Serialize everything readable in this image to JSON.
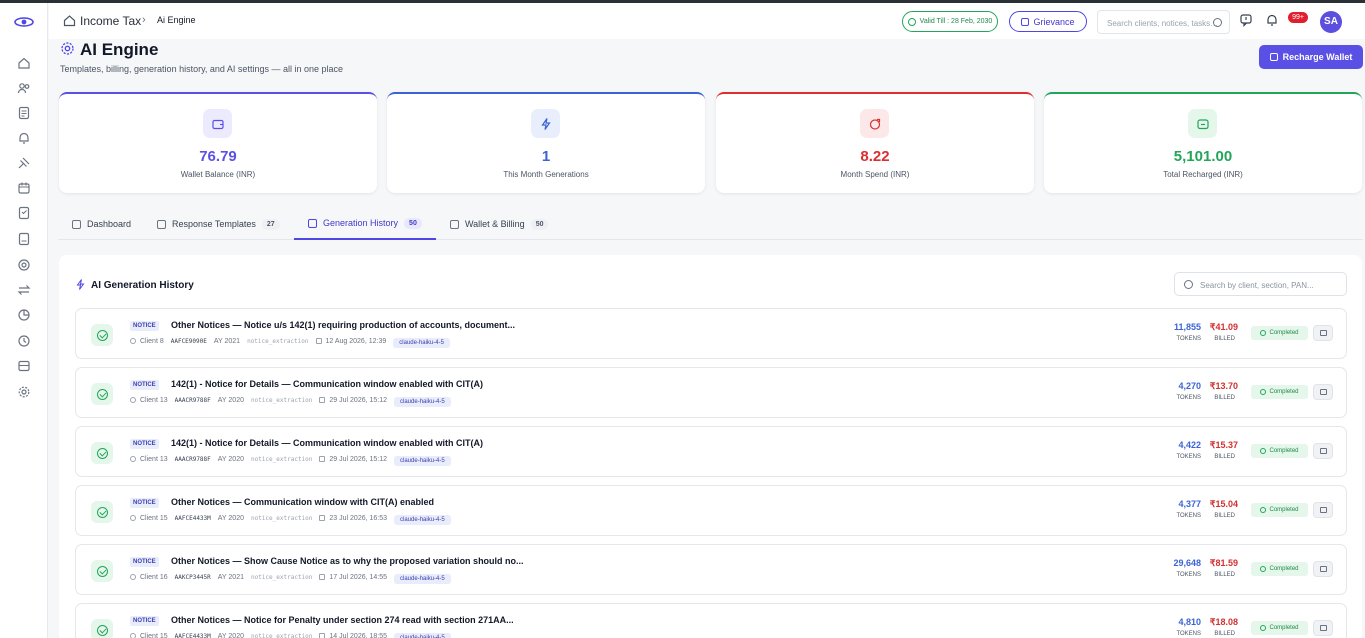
{
  "header": {
    "breadcrumb": [
      "Income Tax",
      "Ai Engine"
    ],
    "breadcrumb_sep": "›",
    "valid_till": "Valid Till : 28 Feb, 2030",
    "grievance_label": "Grievance",
    "search_placeholder": "Search clients, notices, tasks…",
    "notifications_badge": "99+",
    "avatar_initials": "SA"
  },
  "page": {
    "title": "AI Engine",
    "subtitle": "Templates, billing, generation history, and AI settings — all in one place",
    "recharge_label": "Recharge Wallet"
  },
  "stats": [
    {
      "value": "76.79",
      "label": "Wallet Balance (INR)",
      "color": "#5b50e6",
      "icon": "wallet-icon"
    },
    {
      "value": "1",
      "label": "This Month Generations",
      "color": "#3b63d6",
      "icon": "lightning-icon"
    },
    {
      "value": "8.22",
      "label": "Month Spend (INR)",
      "color": "#dc2f2f",
      "icon": "spend-icon"
    },
    {
      "value": "5,101.00",
      "label": "Total Recharged (INR)",
      "color": "#22a55a",
      "icon": "recharge-icon"
    }
  ],
  "tabs": [
    {
      "label": "Dashboard",
      "count": ""
    },
    {
      "label": "Response Templates",
      "count": "27"
    },
    {
      "label": "Generation History",
      "count": "50",
      "active": true
    },
    {
      "label": "Wallet & Billing",
      "count": "50"
    }
  ],
  "history": {
    "title": "AI Generation History",
    "search_placeholder": "Search by client, section, PAN...",
    "tokens_label": "TOKENS",
    "billed_label": "BILLED",
    "rows": [
      {
        "tag": "NOTICE",
        "title": "Other Notices — Notice u/s 142(1) requiring production of accounts, document...",
        "client": "Client 8",
        "pan": "AAFCE9090E",
        "ay": "AY 2021",
        "section": "notice_extraction",
        "date": "12 Aug 2026, 12:39",
        "model": "claude-haiku-4-5",
        "tokens": "11,855",
        "billed": "₹41.09",
        "status": "Completed"
      },
      {
        "tag": "NOTICE",
        "title": "142(1) - Notice for Details — Communication window enabled with CIT(A)",
        "client": "Client 13",
        "pan": "AAACR9788F",
        "ay": "AY 2020",
        "section": "notice_extraction",
        "date": "29 Jul 2026, 15:12",
        "model": "claude-haiku-4-5",
        "tokens": "4,270",
        "billed": "₹13.70",
        "status": "Completed"
      },
      {
        "tag": "NOTICE",
        "title": "142(1) - Notice for Details — Communication window enabled with CIT(A)",
        "client": "Client 13",
        "pan": "AAACR9788F",
        "ay": "AY 2020",
        "section": "notice_extraction",
        "date": "29 Jul 2026, 15:12",
        "model": "claude-haiku-4-5",
        "tokens": "4,422",
        "billed": "₹15.37",
        "status": "Completed"
      },
      {
        "tag": "NOTICE",
        "title": "Other Notices — Communication window with CIT(A) enabled",
        "client": "Client 15",
        "pan": "AAFCE4433M",
        "ay": "AY 2020",
        "section": "notice_extraction",
        "date": "23 Jul 2026, 16:53",
        "model": "claude-haiku-4-5",
        "tokens": "4,377",
        "billed": "₹15.04",
        "status": "Completed"
      },
      {
        "tag": "NOTICE",
        "title": "Other Notices — Show Cause Notice as to why the proposed variation should no...",
        "client": "Client 16",
        "pan": "AAKCP3445R",
        "ay": "AY 2021",
        "section": "notice_extraction",
        "date": "17 Jul 2026, 14:55",
        "model": "claude-haiku-4-5",
        "tokens": "29,648",
        "billed": "₹81.59",
        "status": "Completed"
      },
      {
        "tag": "NOTICE",
        "title": "Other Notices — Notice for Penalty under section 274 read with section 271AA...",
        "client": "Client 15",
        "pan": "AAFCE4433M",
        "ay": "AY 2020",
        "section": "notice_extraction",
        "date": "14 Jul 2026, 18:55",
        "model": "claude-haiku-4-5",
        "tokens": "4,810",
        "billed": "₹18.08",
        "status": "Completed"
      }
    ]
  }
}
